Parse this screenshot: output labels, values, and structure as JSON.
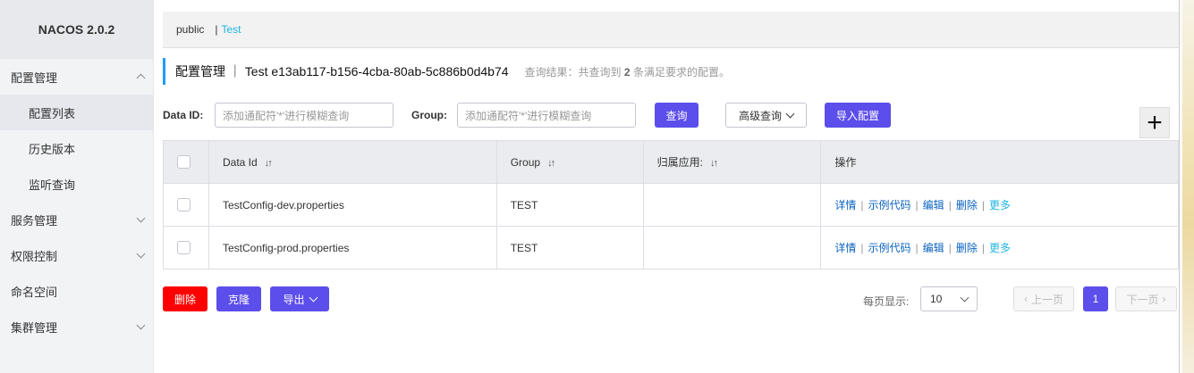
{
  "brand": "NACOS 2.0.2",
  "sidebar": {
    "config_mgmt": "配置管理",
    "config_list": "配置列表",
    "history": "历史版本",
    "listen_query": "监听查询",
    "service_mgmt": "服务管理",
    "auth_ctrl": "权限控制",
    "namespace": "命名空间",
    "cluster_mgmt": "集群管理"
  },
  "breadcrumb": {
    "public": "public",
    "separator": "|",
    "test": "Test"
  },
  "title": {
    "text": "配置管理 ｜ Test  e13ab117-b156-4cba-80ab-5c886b0d4b74",
    "result_prefix": "查询结果：共查询到",
    "result_count": "2",
    "result_suffix": "条满足要求的配置。"
  },
  "filters": {
    "data_id_label": "Data ID:",
    "data_id_placeholder": "添加通配符'*'进行模糊查询",
    "group_label": "Group:",
    "group_placeholder": "添加通配符'*'进行模糊查询",
    "query_button": "查询",
    "advanced_query": "高级查询",
    "import_config": "导入配置",
    "plus": "+"
  },
  "table": {
    "headers": {
      "data_id": "Data Id",
      "group": "Group",
      "app": "归属应用:",
      "ops": "操作",
      "sort_icon": "↓↑"
    },
    "rows": [
      {
        "data_id": "TestConfig-dev.properties",
        "group": "TEST",
        "app": ""
      },
      {
        "data_id": "TestConfig-prod.properties",
        "group": "TEST",
        "app": ""
      }
    ],
    "ops": {
      "detail": "详情",
      "sample_code": "示例代码",
      "edit": "编辑",
      "delete": "删除",
      "more": "更多",
      "bar": "|"
    }
  },
  "bottom": {
    "delete": "删除",
    "clone": "克隆",
    "export": "导出",
    "page_size_label": "每页显示:",
    "page_size": "10",
    "prev": "上一页",
    "current_page": "1",
    "next": "下一页"
  },
  "colors": {
    "primary": "#5c4eea",
    "danger": "#ff0000",
    "link": "#0b63c1",
    "accent": "#1fb5e2",
    "title_bar": "#209bfa"
  }
}
